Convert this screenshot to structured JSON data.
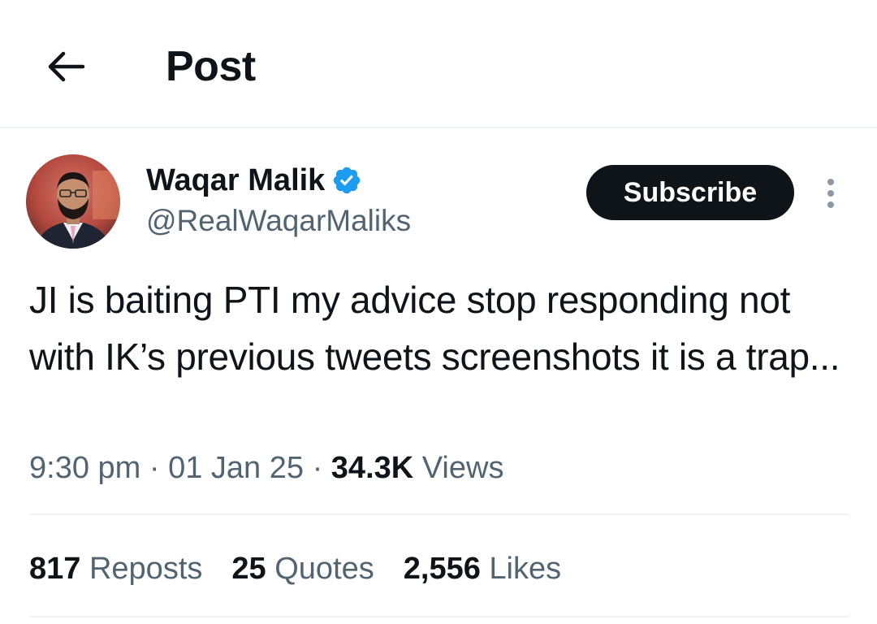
{
  "header": {
    "title": "Post",
    "back_icon": "arrow-left-icon"
  },
  "author": {
    "name": "Waqar Malik",
    "handle": "@RealWaqarMaliks",
    "verified_icon": "verified-badge-icon",
    "verified_color": "#1d9bf0"
  },
  "subscribe_label": "Subscribe",
  "more_icon": "more-vertical-icon",
  "tweet": {
    "text": "JI is baiting PTI my advice stop responding not with IK’s previous tweets screenshots it is a trap...",
    "time": "9:30 pm",
    "sep": "·",
    "date": "01 Jan 25",
    "views_count": "34.3K",
    "views_label": "Views"
  },
  "stats": [
    {
      "count": "817",
      "label": "Reposts"
    },
    {
      "count": "25",
      "label": "Quotes"
    },
    {
      "count": "2,556",
      "label": "Likes"
    }
  ],
  "colors": {
    "text": "#0f1419",
    "secondary": "#536471",
    "border": "#eff3f4",
    "accent": "#1d9bf0"
  }
}
